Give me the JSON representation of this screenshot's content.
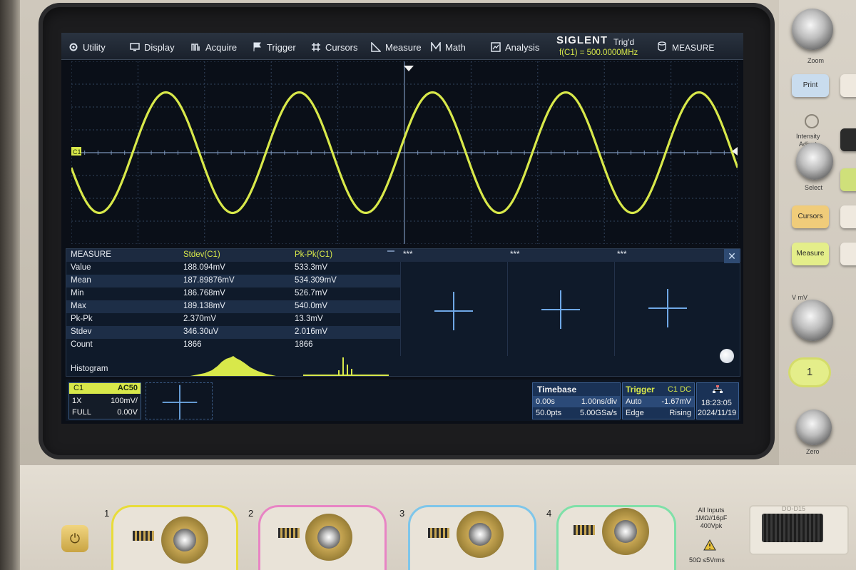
{
  "menu": {
    "items": [
      {
        "label": "Utility",
        "icon": "gear-icon"
      },
      {
        "label": "Display",
        "icon": "monitor-icon"
      },
      {
        "label": "Acquire",
        "icon": "acquire-icon"
      },
      {
        "label": "Trigger",
        "icon": "flag-icon"
      },
      {
        "label": "Cursors",
        "icon": "hash-icon"
      },
      {
        "label": "Measure",
        "icon": "ruler-icon"
      },
      {
        "label": "Math",
        "icon": "math-icon"
      },
      {
        "label": "Analysis",
        "icon": "analysis-icon"
      }
    ],
    "brand": "SIGLENT",
    "trigger_state": "Trig'd",
    "frequency": "f(C1) = 500.0000MHz",
    "measure_button": "MEASURE"
  },
  "waveform": {
    "channel_marker": "C1",
    "color": "#d8e84a",
    "cycles_visible": 5,
    "amplitude_fraction": 0.66
  },
  "measure": {
    "header": {
      "title": "MEASURE",
      "col1": "Stdev(C1)",
      "col2": "Pk-Pk(C1)",
      "slot1": "***",
      "slot2": "***",
      "slot3": "***"
    },
    "rows": [
      {
        "label": "Value",
        "stdev": "188.094mV",
        "pkpk": "533.3mV"
      },
      {
        "label": "Mean",
        "stdev": "187.89876mV",
        "pkpk": "534.309mV"
      },
      {
        "label": "Min",
        "stdev": "186.768mV",
        "pkpk": "526.7mV"
      },
      {
        "label": "Max",
        "stdev": "189.138mV",
        "pkpk": "540.0mV"
      },
      {
        "label": "Pk-Pk",
        "stdev": "2.370mV",
        "pkpk": "13.3mV"
      },
      {
        "label": "Stdev",
        "stdev": "346.30uV",
        "pkpk": "2.016mV"
      },
      {
        "label": "Count",
        "stdev": "1866",
        "pkpk": "1866"
      }
    ],
    "histogram_label": "Histogram",
    "close_symbol": "✕"
  },
  "status": {
    "channel": {
      "name": "C1",
      "coupling": "AC50",
      "probe": "1X",
      "scale": "100mV/",
      "bandwidth": "FULL",
      "offset": "0.00V"
    },
    "timebase": {
      "title": "Timebase",
      "delay": "0.00s",
      "scale": "1.00ns/div",
      "points": "50.0pts",
      "rate": "5.00GSa/s"
    },
    "trigger": {
      "title": "Trigger",
      "source": "C1 DC",
      "mode": "Auto",
      "level": "-1.67mV",
      "type": "Edge",
      "slope": "Rising"
    },
    "clock": {
      "time": "18:23:05",
      "date": "2024/11/19"
    }
  },
  "hardware": {
    "zoom_label": "Zoom",
    "print_label": "Print",
    "intensity_label": "Intensity",
    "adjust_label": "Adjust",
    "select_label": "Select",
    "cursors_label": "Cursors",
    "measure_label": "Measure",
    "channel_button": "1",
    "zero_label": "Zero",
    "vmv_label": "V      mV",
    "channel_numbers": [
      "1",
      "2",
      "3",
      "4"
    ],
    "inputs_label": "All Inputs 1MΩ//16pF 400Vpk",
    "safety_label": "50Ω ≤5Vrms",
    "db15_label": "DO-D15",
    "power_symbol": "⏻",
    "channel_colors": [
      "#e8dc3a",
      "#e884c4",
      "#7ec6ea",
      "#7fe0a8"
    ]
  }
}
